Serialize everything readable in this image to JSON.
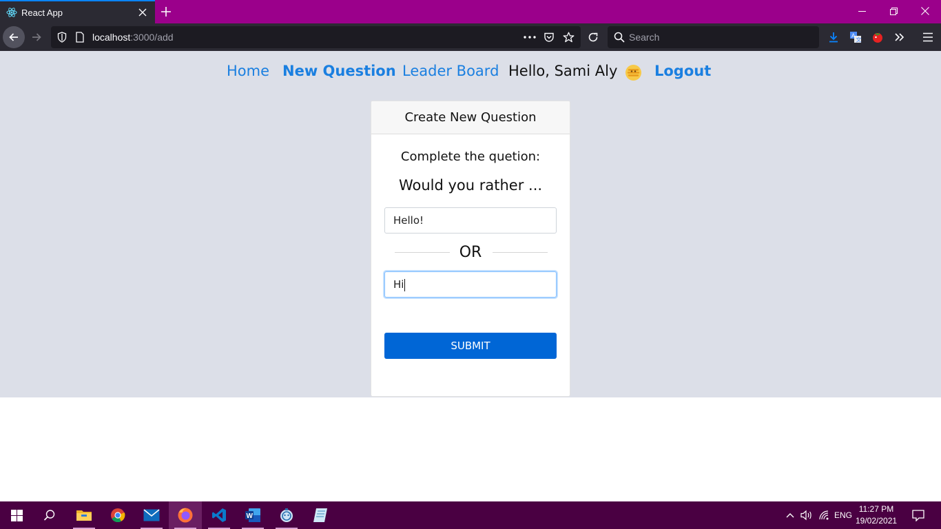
{
  "browser": {
    "tab_title": "React App",
    "url_host": "localhost",
    "url_path": ":3000/add",
    "search_placeholder": "Search",
    "accent": "#9b008b"
  },
  "site_nav": {
    "home": "Home",
    "new_question": "New Question",
    "leader_board": "Leader Board",
    "greeting": "Hello, Sami Aly",
    "logout": "Logout",
    "link_color": "#1a7fe0"
  },
  "card": {
    "header": "Create New Question",
    "instruction": "Complete the quetion:",
    "prompt": "Would you rather ...",
    "option_one_value": "Hello!",
    "option_two_value": "Hi",
    "or_label": "OR",
    "submit_label": "SUBMIT",
    "submit_color": "#0066d6"
  },
  "taskbar": {
    "language": "ENG",
    "time": "11:27 PM",
    "date": "19/02/2021",
    "apps": [
      "start-icon",
      "search-icon",
      "file-explorer-icon",
      "chrome-icon",
      "mail-icon",
      "firefox-icon",
      "vscode-icon",
      "word-icon",
      "app-icon",
      "notes-icon"
    ]
  }
}
